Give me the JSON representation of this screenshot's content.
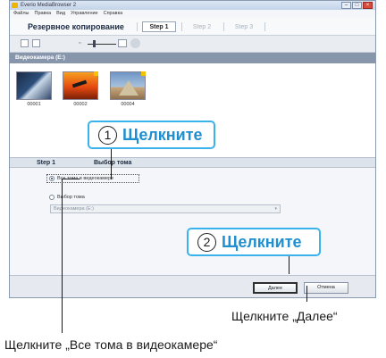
{
  "window": {
    "title": "Everio MediaBrowser 2",
    "controls": {
      "minimize": "–",
      "maximize": "□",
      "close": "×"
    }
  },
  "menubar": {
    "items": [
      "Файлы",
      "Правка",
      "Вид",
      "Управление",
      "Справка"
    ]
  },
  "stepbar": {
    "mode_title": "Резервное копирование",
    "steps": [
      "Step 1",
      "Step 2",
      "Step 3"
    ],
    "active_step": "Step 1"
  },
  "toolbar": {
    "icons": [
      "grid-view-icon",
      "list-view-icon",
      "zoom-out-icon",
      "zoom-slider",
      "zoom-in-icon",
      "settings-icon"
    ]
  },
  "source": {
    "header": "Видеокамера (E:)"
  },
  "thumbnails": [
    {
      "caption": "00001"
    },
    {
      "caption": "00002"
    },
    {
      "caption": "00004"
    }
  ],
  "step_section": {
    "step_label": "Step 1",
    "title": "Выбор тома"
  },
  "options": {
    "all_volumes": "Все тома в видеокамере",
    "select_volume": "Выбор тома",
    "volume_value": "Видеокамера (E:)",
    "selected": "all_volumes"
  },
  "buttons": {
    "next": "Далее",
    "cancel": "Отмена"
  },
  "callouts": {
    "one": {
      "number": "1",
      "text": "Щелкните"
    },
    "two": {
      "number": "2",
      "text": "Щелкните"
    }
  },
  "annotations": {
    "next_note": "Щелкните „Далее“",
    "all_volumes_note": "Щелкните „Все тома в видеокамере“"
  },
  "colors": {
    "callout_border": "#3ab3ec",
    "callout_text": "#1f8fd0",
    "source_header_bg": "#8796ab"
  }
}
